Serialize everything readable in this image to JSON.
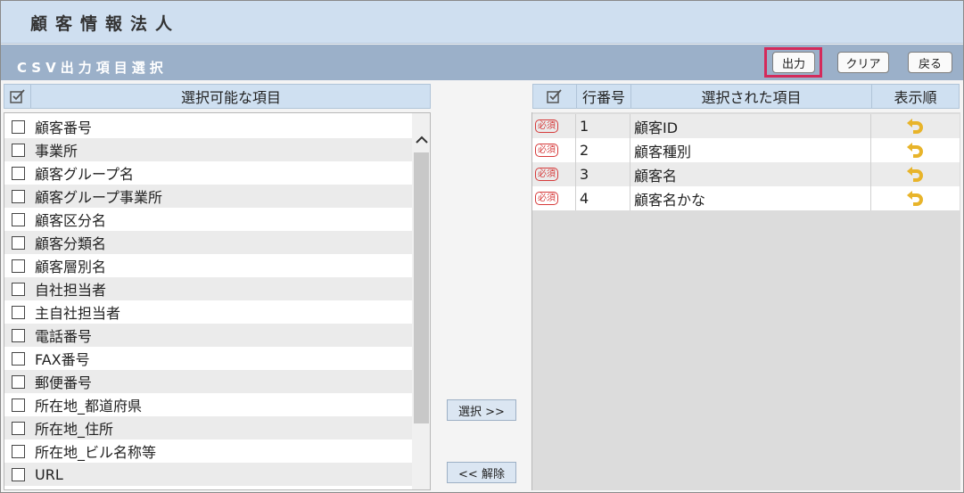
{
  "header": {
    "title": "顧客情報法人"
  },
  "subheader": {
    "title": "CSV出力項目選択"
  },
  "toolbar": {
    "output_label": "出力",
    "clear_label": "クリア",
    "back_label": "戻る"
  },
  "left_panel": {
    "header": "選択可能な項目",
    "items": [
      "顧客番号",
      "事業所",
      "顧客グループ名",
      "顧客グループ事業所",
      "顧客区分名",
      "顧客分類名",
      "顧客層別名",
      "自社担当者",
      "主自社担当者",
      "電話番号",
      "FAX番号",
      "郵便番号",
      "所在地_都道府県",
      "所在地_住所",
      "所在地_ビル名称等",
      "URL"
    ]
  },
  "middle": {
    "select_label": "選択 >>",
    "release_label": "<< 解除"
  },
  "right_panel": {
    "headers": {
      "row_number": "行番号",
      "selected_item": "選択された項目",
      "display_order": "表示順"
    },
    "rows": [
      {
        "badge": "必須",
        "no": "1",
        "item": "顧客ID"
      },
      {
        "badge": "必須",
        "no": "2",
        "item": "顧客種別"
      },
      {
        "badge": "必須",
        "no": "3",
        "item": "顧客名"
      },
      {
        "badge": "必須",
        "no": "4",
        "item": "顧客名かな"
      }
    ]
  },
  "colors": {
    "highlight": "#d42a5a",
    "required_badge": "#d63b3b",
    "order_icon": "#e8b42a"
  }
}
